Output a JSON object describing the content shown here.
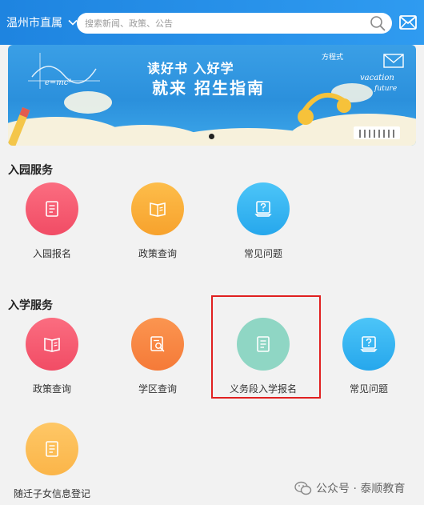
{
  "header": {
    "region": "温州市直属",
    "search_placeholder": "搜索新闻、政策、公告"
  },
  "banner": {
    "line1": "读好书 入好学",
    "line2": "就来 招生指南",
    "doodle1": "e=mc²",
    "doodle2": "vacation",
    "doodle3": "future",
    "doodle4": "方程式"
  },
  "sections": [
    {
      "title": "入园服务",
      "items": [
        {
          "label": "入园报名",
          "icon": "form-icon",
          "color": "#f5566d"
        },
        {
          "label": "政策查询",
          "icon": "book-icon",
          "color": "#f9ab35"
        },
        {
          "label": "常见问题",
          "icon": "question-icon",
          "color": "#30b0ef"
        }
      ]
    },
    {
      "title": "入学服务",
      "items": [
        {
          "label": "政策查询",
          "icon": "book-icon",
          "color": "#f5566d"
        },
        {
          "label": "学区查询",
          "icon": "search-doc-icon",
          "color": "#f7853e"
        },
        {
          "label": "义务段入学报名",
          "icon": "form-icon",
          "color": "#8fd6c4"
        },
        {
          "label": "常见问题",
          "icon": "question-icon",
          "color": "#30b0ef"
        },
        {
          "label": "随迁子女信息登记",
          "icon": "form-icon",
          "color": "#fbb549"
        }
      ]
    }
  ],
  "watermark": "公众号 · 泰顺教育"
}
